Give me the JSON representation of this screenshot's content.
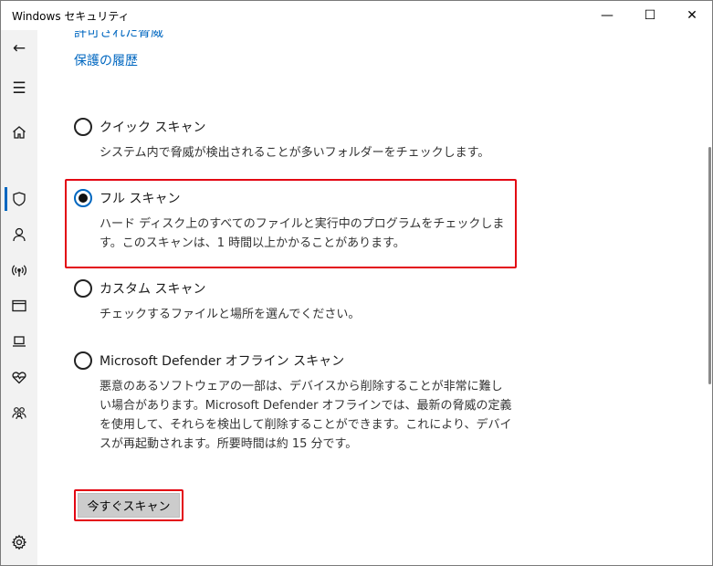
{
  "window": {
    "title": "Windows セキュリティ",
    "minimize": "—",
    "maximize": "☐",
    "close": "✕"
  },
  "sidebar": {
    "items": [
      {
        "icon": "back-arrow-icon",
        "glyph": "←"
      },
      {
        "icon": "hamburger-menu-icon",
        "glyph": "☰"
      },
      {
        "icon": "home-icon"
      },
      {
        "icon": "shield-icon",
        "active": true
      },
      {
        "icon": "person-icon"
      },
      {
        "icon": "wireless-icon"
      },
      {
        "icon": "app-browser-icon"
      },
      {
        "icon": "laptop-icon"
      },
      {
        "icon": "heart-health-icon"
      },
      {
        "icon": "family-icon"
      },
      {
        "icon": "settings-gear-icon"
      }
    ]
  },
  "links": {
    "allowed_threats": "許可された脅威",
    "protection_history": "保護の履歴"
  },
  "scan_options": [
    {
      "label": "クイック スキャン",
      "description": "システム内で脅威が検出されることが多いフォルダーをチェックします。",
      "checked": false
    },
    {
      "label": "フル スキャン",
      "description": "ハード ディスク上のすべてのファイルと実行中のプログラムをチェックします。このスキャンは、1 時間以上かかることがあります。",
      "checked": true
    },
    {
      "label": "カスタム スキャン",
      "description": "チェックするファイルと場所を選んでください。",
      "checked": false
    },
    {
      "label": "Microsoft Defender オフライン スキャン",
      "description": "悪意のあるソフトウェアの一部は、デバイスから削除することが非常に難しい場合があります。Microsoft Defender オフラインでは、最新の脅威の定義を使用して、それらを検出して削除することができます。これにより、デバイスが再起動されます。所要時間は約 15 分です。",
      "checked": false
    }
  ],
  "scan_now_button": "今すぐスキャン",
  "colors": {
    "accent": "#0067c0",
    "highlight_border": "#e30613",
    "sidebar_bg": "#f2f2f2",
    "button_bg": "#cccccc"
  }
}
